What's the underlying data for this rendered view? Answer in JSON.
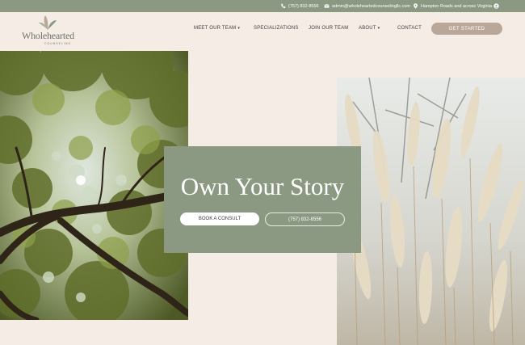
{
  "topbar": {
    "phone": "(757) 832-8556",
    "email": "admin@wholeheartedcounselingllc.com",
    "location": "Hampton Roads and across Virginia"
  },
  "brand": {
    "name": "Wholehearted",
    "tagline": "COUNSELING"
  },
  "nav": {
    "items": [
      {
        "label": "MEET OUR TEAM",
        "has_dropdown": true
      },
      {
        "label": "SPECIALIZATIONS",
        "has_dropdown": false
      },
      {
        "label": "JOIN OUR TEAM",
        "has_dropdown": false
      },
      {
        "label": "ABOUT",
        "has_dropdown": true
      },
      {
        "label": "CONTACT",
        "has_dropdown": false
      }
    ],
    "cta": "GET STARTED",
    "caret": "▾"
  },
  "hero": {
    "title": "Own Your Story",
    "primary_button": "BOOK A CONSULT",
    "secondary_button": "(757) 832-8556"
  },
  "images": {
    "left": "tree-canopy-photo",
    "right": "pampas-grass-photo"
  },
  "colors": {
    "sage": "#8c9982",
    "background": "#f6ece6",
    "cta": "#b9a89a",
    "text": "#3d3d3d"
  }
}
